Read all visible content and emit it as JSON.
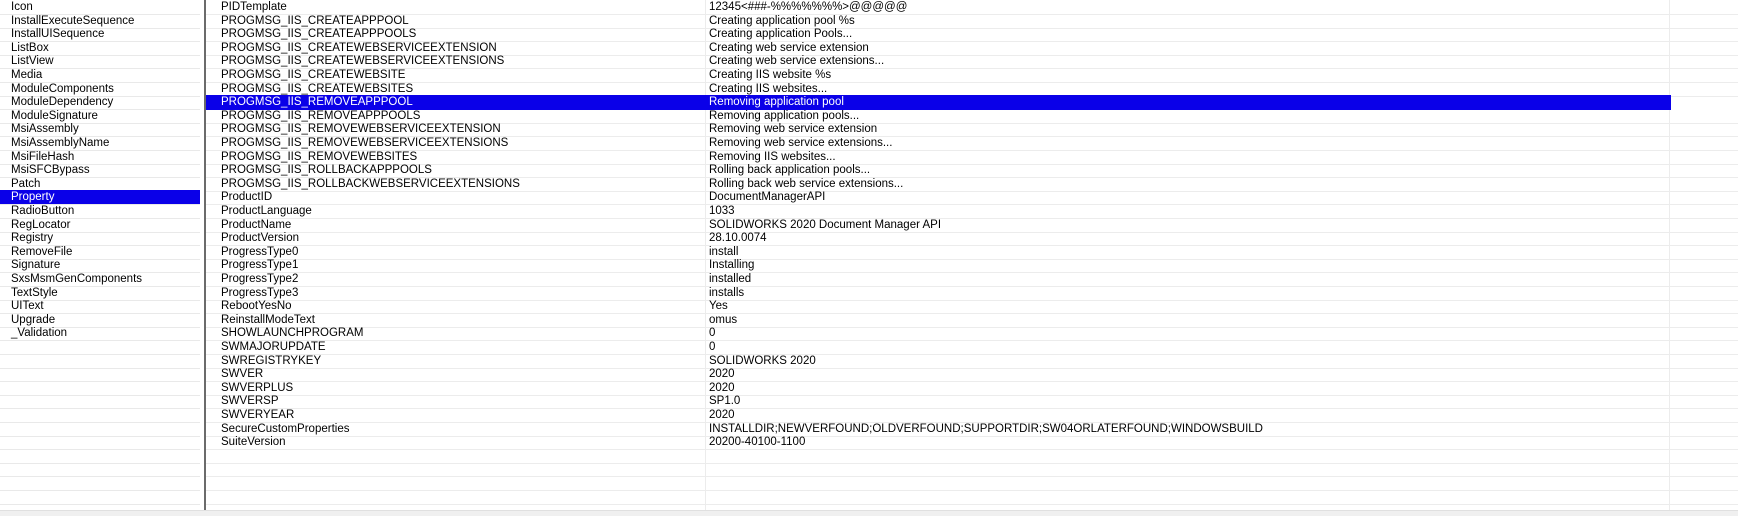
{
  "tables": {
    "items": [
      "Icon",
      "InstallExecuteSequence",
      "InstallUISequence",
      "ListBox",
      "ListView",
      "Media",
      "ModuleComponents",
      "ModuleDependency",
      "ModuleSignature",
      "MsiAssembly",
      "MsiAssemblyName",
      "MsiFileHash",
      "MsiSFCBypass",
      "Patch",
      "Property",
      "RadioButton",
      "RegLocator",
      "Registry",
      "RemoveFile",
      "Signature",
      "SxsMsmGenComponents",
      "TextStyle",
      "UIText",
      "Upgrade",
      "_Validation"
    ],
    "selected_index": 14
  },
  "grid": {
    "selected_index": 7,
    "rows": [
      {
        "property": "PIDTemplate",
        "value": "12345<###-%%%%%%%>@@@@@"
      },
      {
        "property": "PROGMSG_IIS_CREATEAPPPOOL",
        "value": "Creating application pool %s"
      },
      {
        "property": "PROGMSG_IIS_CREATEAPPPOOLS",
        "value": "Creating application Pools..."
      },
      {
        "property": "PROGMSG_IIS_CREATEWEBSERVICEEXTENSION",
        "value": "Creating web service extension"
      },
      {
        "property": "PROGMSG_IIS_CREATEWEBSERVICEEXTENSIONS",
        "value": "Creating web service extensions..."
      },
      {
        "property": "PROGMSG_IIS_CREATEWEBSITE",
        "value": "Creating IIS website %s"
      },
      {
        "property": "PROGMSG_IIS_CREATEWEBSITES",
        "value": "Creating IIS websites..."
      },
      {
        "property": "PROGMSG_IIS_REMOVEAPPPOOL",
        "value": "Removing application pool"
      },
      {
        "property": "PROGMSG_IIS_REMOVEAPPPOOLS",
        "value": "Removing application pools..."
      },
      {
        "property": "PROGMSG_IIS_REMOVEWEBSERVICEEXTENSION",
        "value": "Removing web service extension"
      },
      {
        "property": "PROGMSG_IIS_REMOVEWEBSERVICEEXTENSIONS",
        "value": "Removing web service extensions..."
      },
      {
        "property": "PROGMSG_IIS_REMOVEWEBSITES",
        "value": "Removing IIS websites..."
      },
      {
        "property": "PROGMSG_IIS_ROLLBACKAPPPOOLS",
        "value": "Rolling back application pools..."
      },
      {
        "property": "PROGMSG_IIS_ROLLBACKWEBSERVICEEXTENSIONS",
        "value": "Rolling back web service extensions..."
      },
      {
        "property": "ProductID",
        "value": "DocumentManagerAPI"
      },
      {
        "property": "ProductLanguage",
        "value": "1033"
      },
      {
        "property": "ProductName",
        "value": "SOLIDWORKS 2020 Document Manager API"
      },
      {
        "property": "ProductVersion",
        "value": "28.10.0074"
      },
      {
        "property": "ProgressType0",
        "value": "install"
      },
      {
        "property": "ProgressType1",
        "value": "Installing"
      },
      {
        "property": "ProgressType2",
        "value": "installed"
      },
      {
        "property": "ProgressType3",
        "value": "installs"
      },
      {
        "property": "RebootYesNo",
        "value": "Yes"
      },
      {
        "property": "ReinstallModeText",
        "value": "omus"
      },
      {
        "property": "SHOWLAUNCHPROGRAM",
        "value": "0"
      },
      {
        "property": "SWMAJORUPDATE",
        "value": "0"
      },
      {
        "property": "SWREGISTRYKEY",
        "value": "SOLIDWORKS 2020"
      },
      {
        "property": "SWVER",
        "value": "2020"
      },
      {
        "property": "SWVERPLUS",
        "value": "2020"
      },
      {
        "property": "SWVERSP",
        "value": "SP1.0"
      },
      {
        "property": "SWVERYEAR",
        "value": "2020"
      },
      {
        "property": "SecureCustomProperties",
        "value": "INSTALLDIR;NEWVERFOUND;OLDVERFOUND;SUPPORTDIR;SW04ORLATERFOUND;WINDOWSBUILD"
      },
      {
        "property": "SuiteVersion",
        "value": "20200-40100-1100"
      }
    ]
  },
  "colors": {
    "selection": "#0a00e8",
    "splitter": "#6b6b6b",
    "gridline": "#ececec"
  }
}
